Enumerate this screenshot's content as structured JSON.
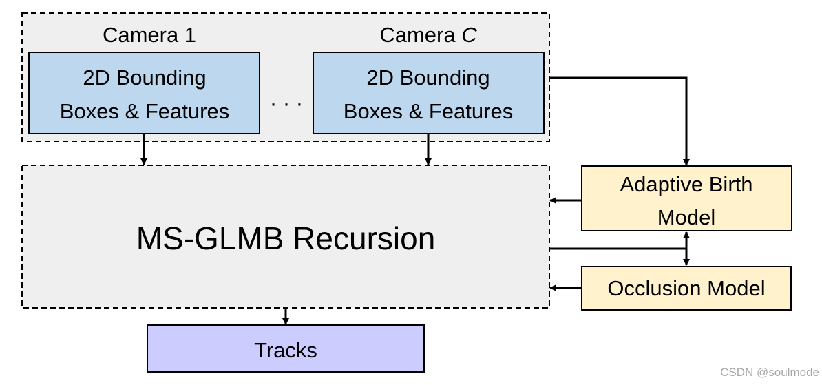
{
  "cameras": [
    {
      "label": "Camera 1",
      "box_line1": "2D Bounding",
      "box_line2": "Boxes & Features"
    },
    {
      "label_prefix": "Camera ",
      "label_italic": "C",
      "box_line1": "2D Bounding",
      "box_line2": "Boxes & Features"
    }
  ],
  "ellipsis": "· · ·",
  "recursion": {
    "label": "MS-GLMB Recursion"
  },
  "birth_model": {
    "line1": "Adaptive Birth",
    "line2": "Model"
  },
  "occlusion_model": {
    "label": "Occlusion Model"
  },
  "tracks": {
    "label": "Tracks"
  },
  "watermark": "CSDN @soulmode",
  "colors": {
    "camera_box": "#bdd7ee",
    "group_fill": "#efefef",
    "model_box": "#fff2cc",
    "tracks_box": "#ccccff"
  }
}
